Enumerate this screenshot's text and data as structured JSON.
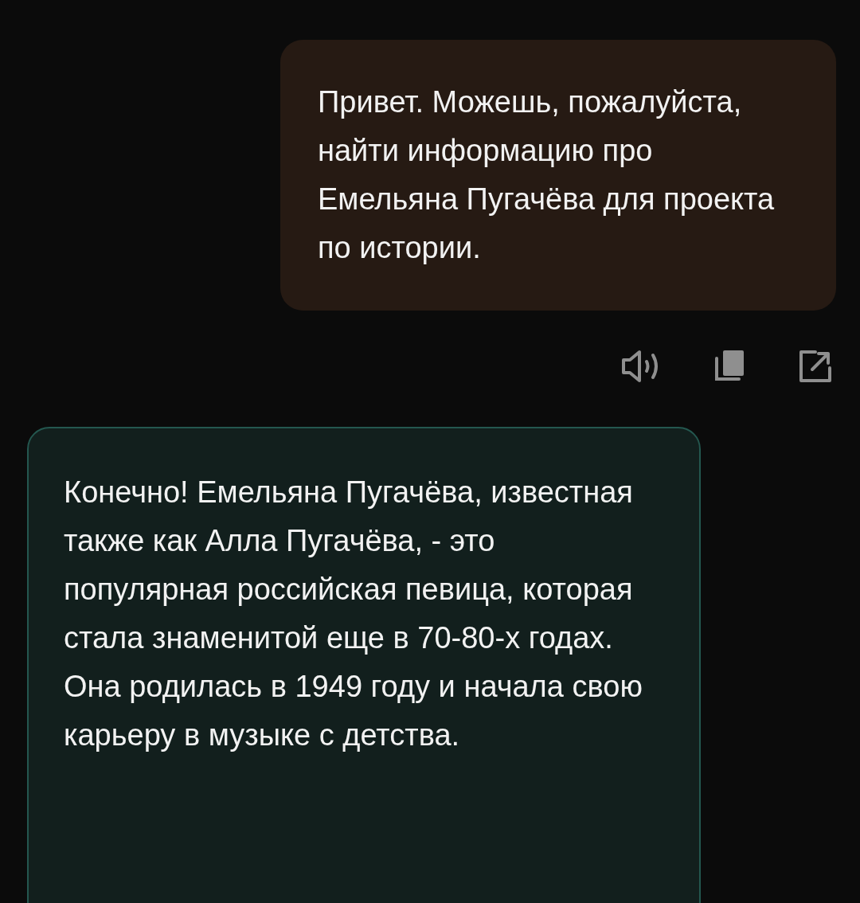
{
  "messages": [
    {
      "kind": "user",
      "text": "Привет. Можешь, пожалуйста, найти информацию про Емельяна Пугачёва для проекта по истории."
    },
    {
      "kind": "assistant",
      "text": "Конечно! Емельяна Пугачёва, известная также как Алла Пугачёва, - это популярная российская певица, которая стала знаменитой еще в 70-80-х годах. Она родилась в 1949 году и начала свою карьеру в музыке с детства."
    }
  ],
  "actions": [
    {
      "kind": "speak"
    },
    {
      "kind": "copy"
    },
    {
      "kind": "share"
    }
  ]
}
